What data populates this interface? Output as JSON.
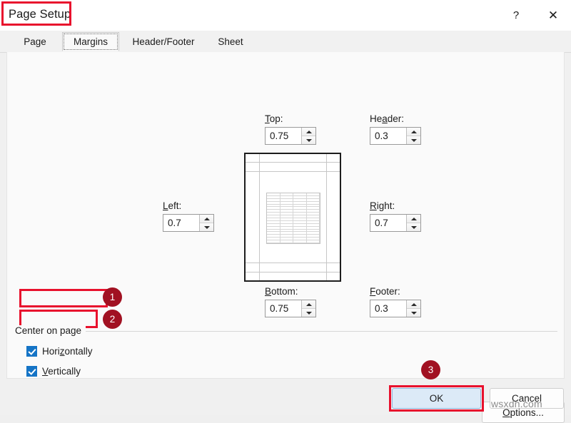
{
  "window": {
    "title": "Page Setup",
    "help_icon": "question-mark-icon",
    "close_icon": "close-icon"
  },
  "tabs": [
    {
      "id": "page",
      "label": "Page",
      "selected": false
    },
    {
      "id": "margins",
      "label": "Margins",
      "selected": true
    },
    {
      "id": "header_footer",
      "label": "Header/Footer",
      "selected": false
    },
    {
      "id": "sheet",
      "label": "Sheet",
      "selected": false
    }
  ],
  "margins": {
    "top": {
      "label": "Top:",
      "accesskey": "T",
      "value": "0.75"
    },
    "header": {
      "label": "Header:",
      "accesskey": "a",
      "value": "0.3"
    },
    "left": {
      "label": "Left:",
      "accesskey": "L",
      "value": "0.7"
    },
    "right": {
      "label": "Right:",
      "accesskey": "R",
      "value": "0.7"
    },
    "bottom": {
      "label": "Bottom:",
      "accesskey": "B",
      "value": "0.75"
    },
    "footer": {
      "label": "Footer:",
      "accesskey": "F",
      "value": "0.3"
    }
  },
  "preview": {
    "name": "page-preview",
    "grid_columns": 4,
    "grid_rows": 18
  },
  "center_on_page": {
    "legend": "Center on page",
    "horizontally": {
      "label_before": "Hori",
      "accesskey": "z",
      "label_after": "ontally",
      "checked": true
    },
    "vertically": {
      "label_before": "",
      "accesskey": "V",
      "label_after": "ertically",
      "checked": true
    }
  },
  "buttons": {
    "options": {
      "label_before": "",
      "accesskey": "O",
      "label_after": "ptions..."
    },
    "ok": "OK",
    "cancel": "Cancel"
  },
  "annotations": {
    "step1": "1",
    "step2": "2",
    "step3": "3",
    "box_color": "#e8112d",
    "circle_color": "#a11122"
  },
  "watermark": "wsxdn.com"
}
